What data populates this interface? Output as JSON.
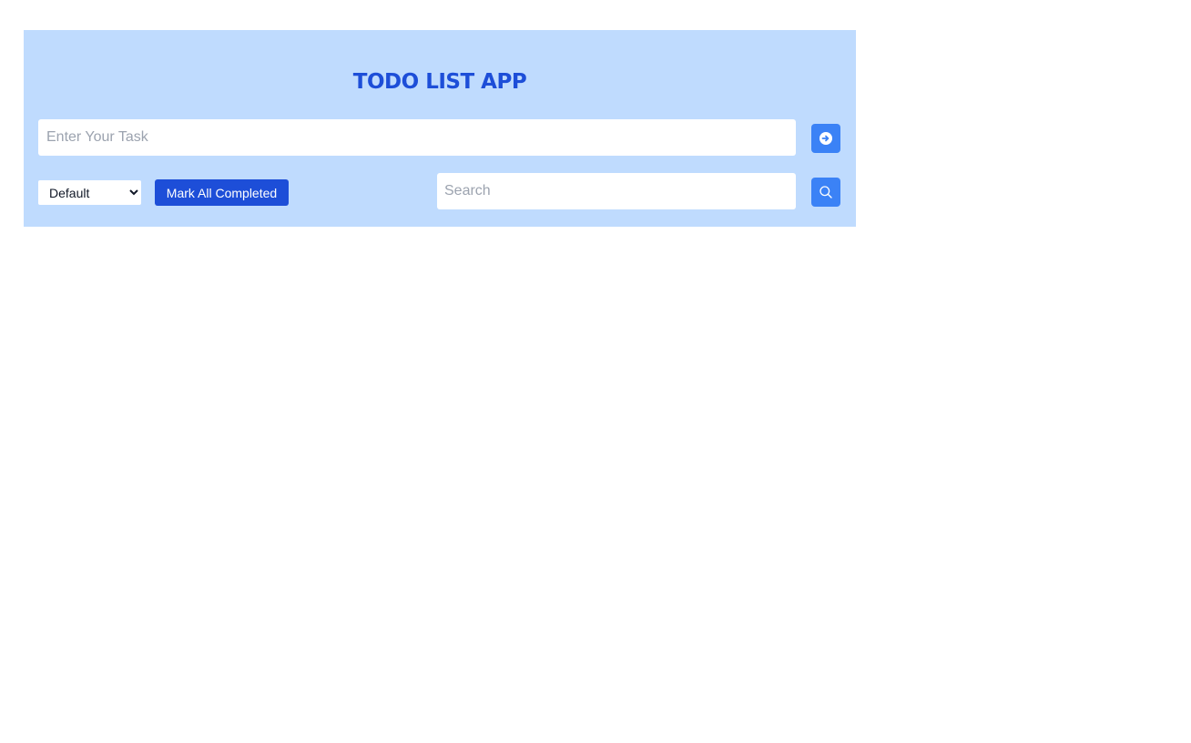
{
  "app": {
    "title": "TODO LIST APP"
  },
  "task_input": {
    "value": "",
    "placeholder": "Enter Your Task"
  },
  "submit_button": {
    "icon": "arrow-circle-right-icon"
  },
  "filter": {
    "selected": "Default",
    "options": [
      "Default"
    ]
  },
  "mark_all_button": {
    "label": "Mark All Completed"
  },
  "search": {
    "value": "",
    "placeholder": "Search"
  },
  "search_button": {
    "icon": "search-icon"
  },
  "colors": {
    "panel_background": "#bfdbfe",
    "title": "#1d4ed8",
    "primary_button": "#1d4ed8",
    "icon_button": "#3b82f6"
  }
}
